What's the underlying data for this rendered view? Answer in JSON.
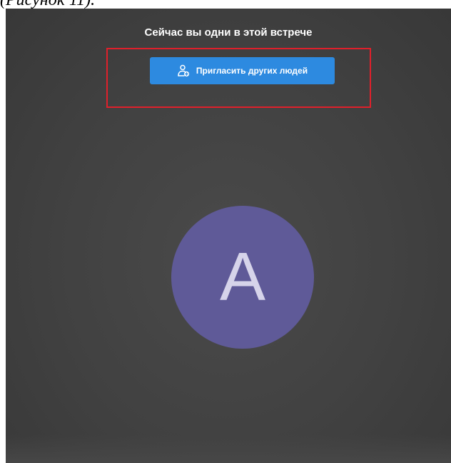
{
  "document": {
    "caption_fragment": "(Рисунок 11)."
  },
  "meeting": {
    "status_message": "Сейчас вы одни в этой встрече",
    "invite_button_label": "Пригласить других людей",
    "invite_icon": "add-person-icon",
    "participant_initial": "A"
  },
  "colors": {
    "screen_background": "#414141",
    "invite_button": "#2d8ae0",
    "highlight_border": "#e0202b",
    "avatar_background": "#5f5a98"
  }
}
